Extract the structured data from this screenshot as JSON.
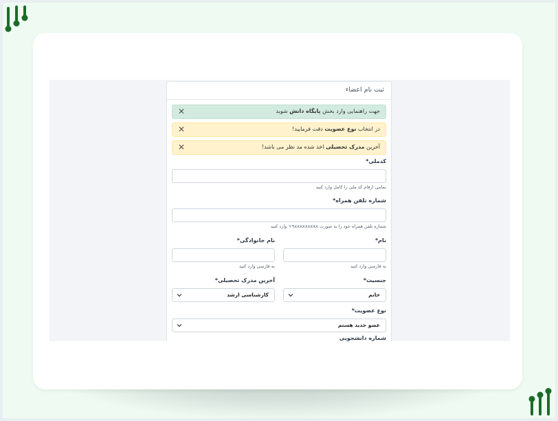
{
  "form": {
    "title": "ثبت نام اعضاء",
    "alerts": [
      {
        "type": "success",
        "pre": "جهت راهنمایی وارد بخش ",
        "bold": "پایگاه دانش",
        "post": " شوید"
      },
      {
        "type": "warning",
        "pre": "در انتخاب ",
        "bold": "نوع عضویت",
        "post": " دقت فرمایید!"
      },
      {
        "type": "warning",
        "pre": "آخرین ",
        "bold": "مدرک تحصیلی",
        "post": " اخذ شده مد نظر می باشد!"
      }
    ],
    "national_code": {
      "label": "کدملی*",
      "value": "",
      "help": "تمامی ارقام کد ملی را کامل وارد کنید"
    },
    "mobile": {
      "label": "شماره تلفن همراه*",
      "value": "",
      "help": "شماره تلفن همراه خود را به صورت ۹xxxxxxxxx+ وارد کنید"
    },
    "first_name": {
      "label": "نام*",
      "value": "",
      "help": "به فارسی وارد کنید"
    },
    "last_name": {
      "label": "نام خانوادگی*",
      "value": "",
      "help": "به فارسی وارد کنید"
    },
    "gender": {
      "label": "جنسیت*",
      "selected": "خانم"
    },
    "degree": {
      "label": "آخرین مدرک تحصیلی*",
      "selected": "کارشناسی ارشد"
    },
    "membership": {
      "label": "نوع عضویت*",
      "selected": "عضو جدید هستم"
    },
    "cut_off_label": "شماره دانشجویی"
  },
  "colors": {
    "brand_green": "#1d6b2a",
    "mint_background": "#effbf2",
    "alert_success": "#d3ebdf",
    "alert_warning": "#fff2cc"
  },
  "icons": [
    "logo-icon",
    "close-icon",
    "chevron-down-icon"
  ]
}
